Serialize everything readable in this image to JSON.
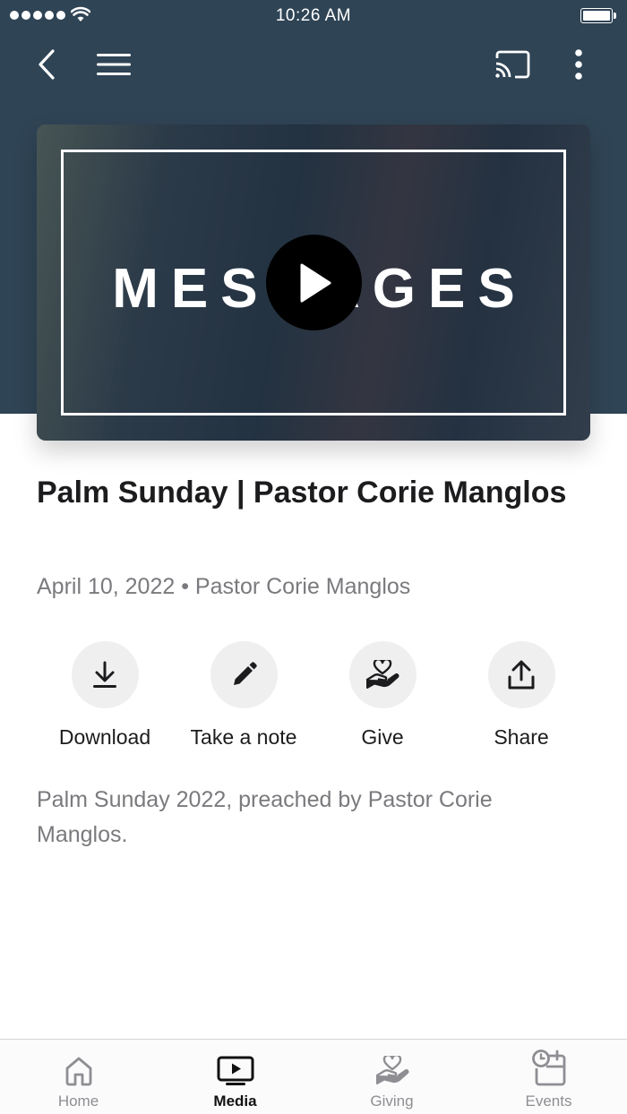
{
  "status_bar": {
    "time": "10:26 AM"
  },
  "nav": {
    "back_icon": "chevron-left-icon",
    "menu_icon": "hamburger-icon",
    "cast_icon": "cast-icon",
    "more_icon": "more-vertical-icon"
  },
  "hero": {
    "overlay_text": "MESSAGES",
    "play_icon": "play-icon"
  },
  "sermon": {
    "title": "Palm Sunday | Pastor Corie Manglos",
    "meta": "April 10, 2022 • Pastor Corie Manglos",
    "description": "Palm Sunday 2022, preached by Pastor Corie Manglos."
  },
  "actions": [
    {
      "label": "Download",
      "icon": "download-icon"
    },
    {
      "label": "Take a note",
      "icon": "pencil-icon"
    },
    {
      "label": "Give",
      "icon": "hand-heart-icon"
    },
    {
      "label": "Share",
      "icon": "share-icon"
    }
  ],
  "tabs": [
    {
      "label": "Home",
      "icon": "home-icon",
      "active": false
    },
    {
      "label": "Media",
      "icon": "tv-play-icon",
      "active": true
    },
    {
      "label": "Giving",
      "icon": "hand-heart-icon",
      "active": false
    },
    {
      "label": "Events",
      "icon": "calendar-clock-icon",
      "active": false
    }
  ],
  "colors": {
    "header_band": "#2f4455",
    "action_circle": "#efeff0",
    "secondary_text": "#7a7a7e",
    "active_tab": "#111111",
    "inactive_tab": "#8e8e93"
  }
}
